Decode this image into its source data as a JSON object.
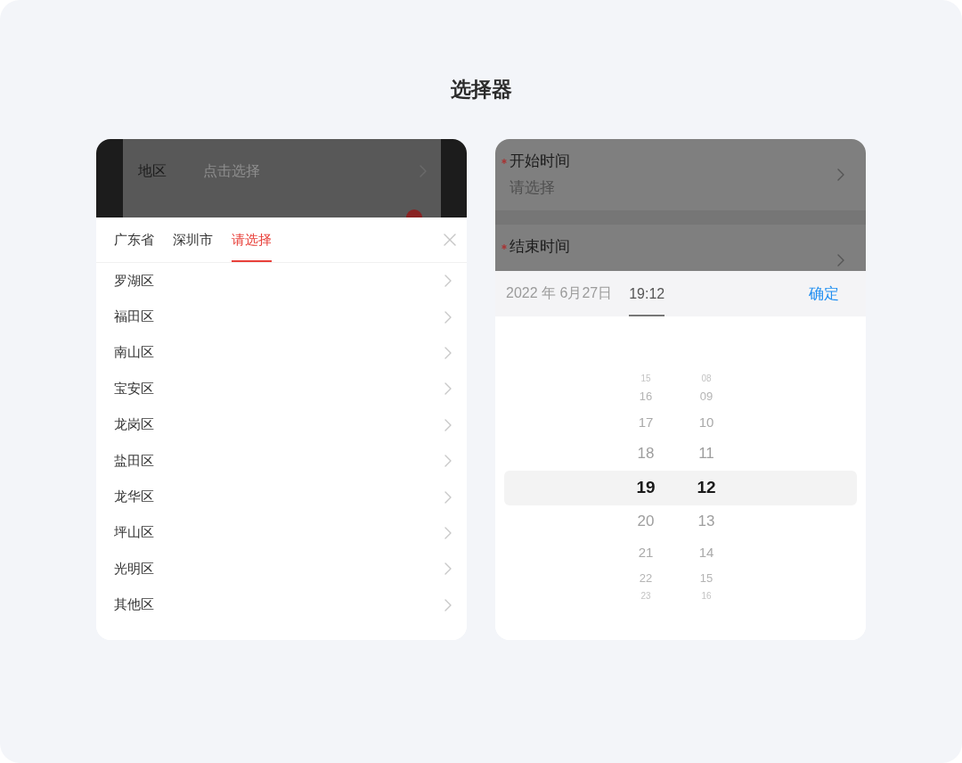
{
  "title": "选择器",
  "region_picker": {
    "backdrop_rows": [
      {
        "kind": "select",
        "label": "地区",
        "placeholder": "点击选择"
      },
      {
        "kind": "text"
      }
    ],
    "tabs": [
      {
        "label": "广东省",
        "selected": false
      },
      {
        "label": "深圳市",
        "selected": false
      },
      {
        "label": "请选择",
        "selected": true
      }
    ],
    "options": [
      "罗湖区",
      "福田区",
      "南山区",
      "宝安区",
      "龙岗区",
      "盐田区",
      "龙华区",
      "坪山区",
      "光明区",
      "其他区"
    ]
  },
  "time_picker": {
    "backdrop_fields": [
      {
        "label": "开始时间",
        "required": true,
        "placeholder": "请选择"
      },
      {
        "label": "结束时间",
        "required": true
      }
    ],
    "tabs": [
      {
        "label": "2022 年 6月27日",
        "selected": false
      },
      {
        "label": "19:12",
        "selected": true
      }
    ],
    "confirm": "确定",
    "hours": [
      {
        "value": "15",
        "selected": false
      },
      {
        "value": "16",
        "selected": false
      },
      {
        "value": "17",
        "selected": false
      },
      {
        "value": "18",
        "selected": false
      },
      {
        "value": "19",
        "selected": true
      },
      {
        "value": "20",
        "selected": false
      },
      {
        "value": "21",
        "selected": false
      },
      {
        "value": "22",
        "selected": false
      },
      {
        "value": "23",
        "selected": false
      }
    ],
    "minutes": [
      {
        "value": "08",
        "selected": false
      },
      {
        "value": "09",
        "selected": false
      },
      {
        "value": "10",
        "selected": false
      },
      {
        "value": "11",
        "selected": false
      },
      {
        "value": "12",
        "selected": true
      },
      {
        "value": "13",
        "selected": false
      },
      {
        "value": "14",
        "selected": false
      },
      {
        "value": "15",
        "selected": false
      },
      {
        "value": "16",
        "selected": false
      }
    ]
  }
}
